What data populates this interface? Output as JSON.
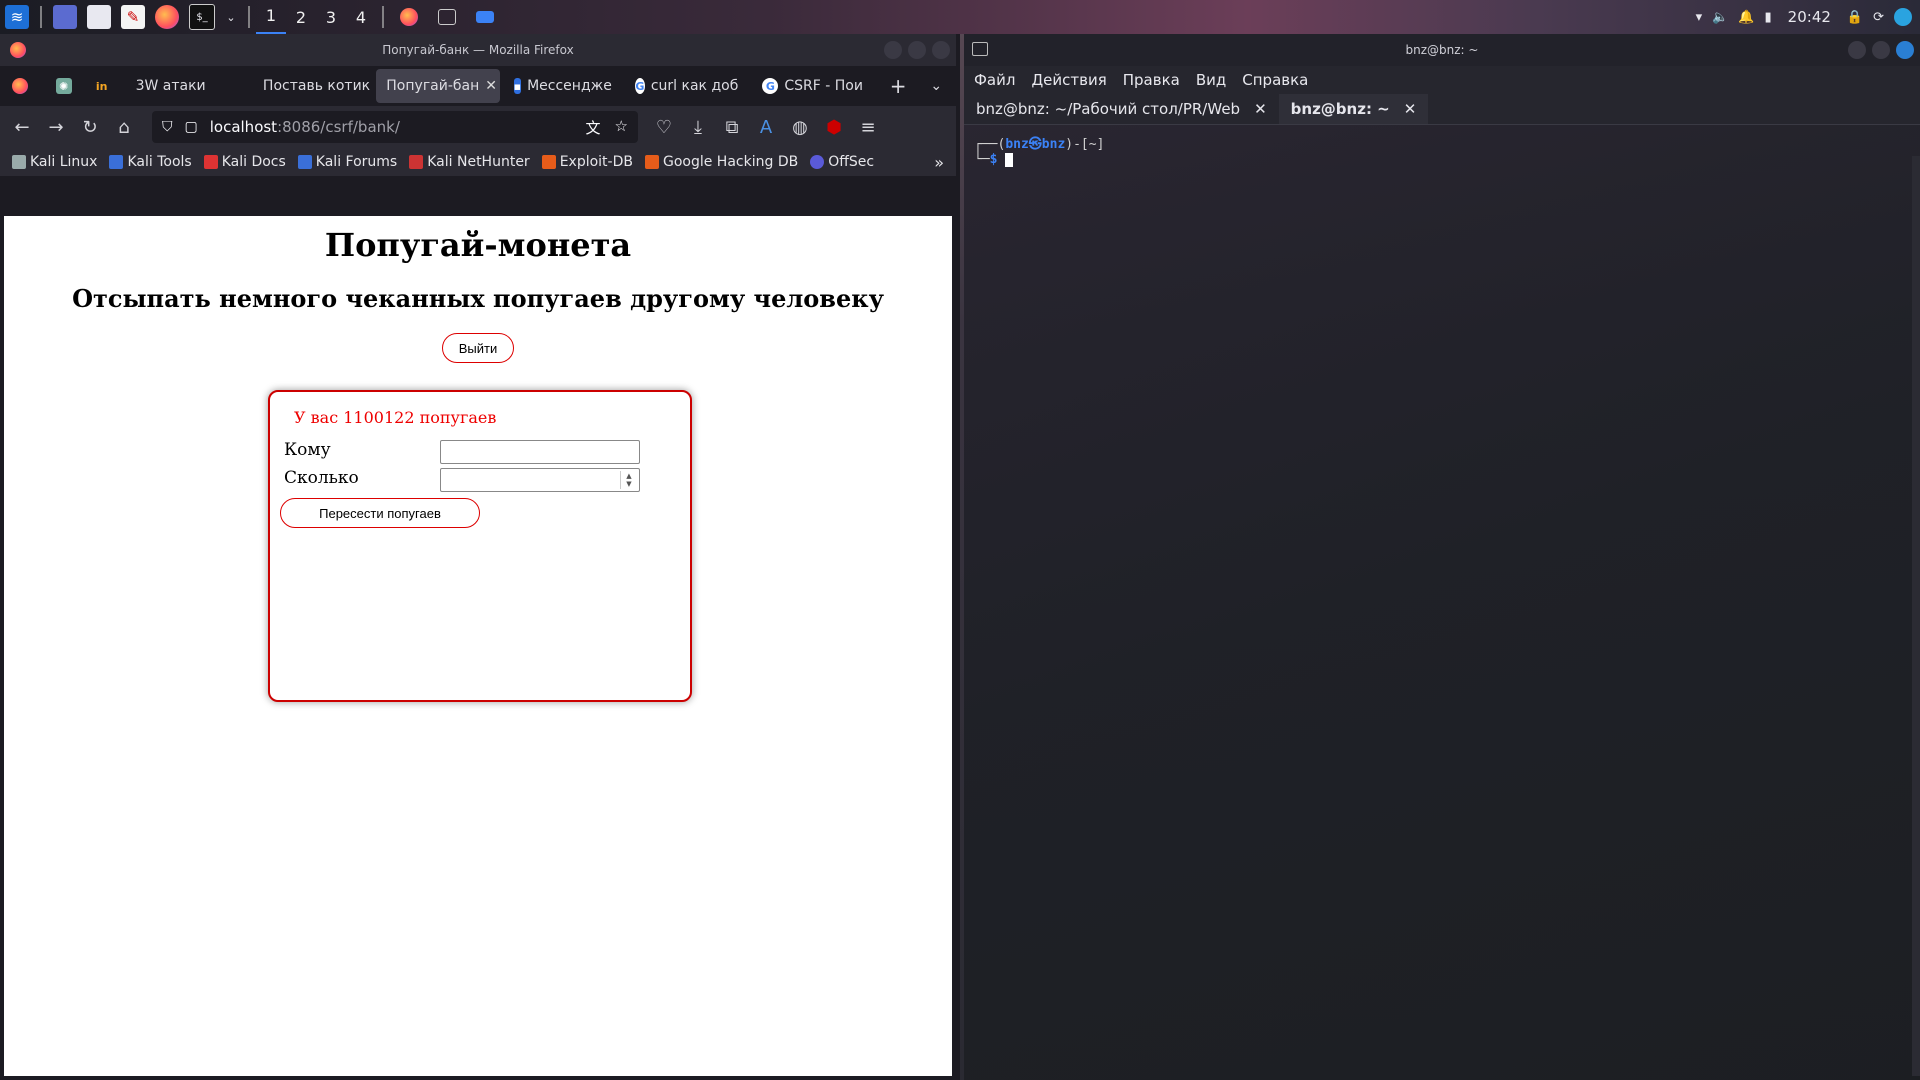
{
  "taskbar": {
    "workspaces": [
      "1",
      "2",
      "3",
      "4"
    ],
    "clock": "20:42"
  },
  "firefox": {
    "window_title": "Попугай-банк — Mozilla Firefox",
    "tabs": [
      {
        "label": "3W атаки"
      },
      {
        "label": "Поставь котик"
      },
      {
        "label": "Попугай-бан"
      },
      {
        "label": "Мессендже"
      },
      {
        "label": "curl как доб"
      },
      {
        "label": "CSRF - Пои"
      }
    ],
    "url_host": "localhost",
    "url_rest": ":8086/csrf/bank/",
    "bookmarks": [
      "Kali Linux",
      "Kali Tools",
      "Kali Docs",
      "Kali Forums",
      "Kali NetHunter",
      "Exploit-DB",
      "Google Hacking DB",
      "OffSec"
    ]
  },
  "page": {
    "title": "Попугай-монета",
    "subtitle": "Отсыпать немного чеканных попугаев другому человеку",
    "logout_label": "Выйти",
    "balance_text": "У вас 1100122 попугаев",
    "to_label": "Кому",
    "amount_label": "Сколько",
    "to_value": "",
    "amount_value": "",
    "send_label": "Пересести попугаев"
  },
  "terminal": {
    "window_title": "bnz@bnz: ~",
    "menu": [
      "Файл",
      "Действия",
      "Правка",
      "Вид",
      "Справка"
    ],
    "tabs": [
      {
        "label": "bnz@bnz: ~/Рабочий стол/PR/Web"
      },
      {
        "label": "bnz@bnz: ~"
      }
    ],
    "prompt_user": "bnz㉿bnz",
    "prompt_dir": "~"
  },
  "colors": {
    "accent": "#3b82f6",
    "danger": "#cc0000"
  }
}
